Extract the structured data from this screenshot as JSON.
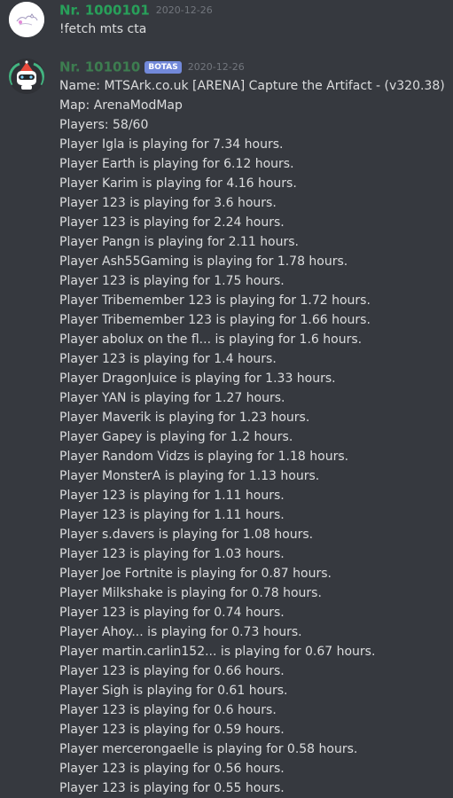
{
  "messages": [
    {
      "username": "Nr. 1000101",
      "timestamp": "2020-12-26",
      "text": "!fetch mts cta"
    },
    {
      "username": "Nr. 101010",
      "bot_tag": "BOTAS",
      "timestamp": "2020-12-26",
      "lines": [
        "Name: MTSArk.co.uk [ARENA] Capture the Artifact - (v320.38)",
        "Map: ArenaModMap",
        "Players: 58/60",
        "Player Igla is playing for 7.34 hours.",
        "Player Earth is playing for 6.12 hours.",
        "Player Karim is playing for 4.16 hours.",
        "Player 123 is playing for 3.6 hours.",
        "Player 123 is playing for 2.24 hours.",
        "Player Pangn is playing for 2.11 hours.",
        "Player Ash55Gaming is playing for 1.78 hours.",
        "Player 123 is playing for 1.75 hours.",
        "Player Tribemember 123 is playing for 1.72 hours.",
        "Player Tribemember 123 is playing for 1.66 hours.",
        "Player abolux on the fl... is playing for 1.6 hours.",
        "Player 123 is playing for 1.4 hours.",
        "Player DragonJuice is playing for 1.33 hours.",
        "Player YAN is playing for 1.27 hours.",
        "Player Maverik is playing for 1.23 hours.",
        "Player Gapey is playing for 1.2 hours.",
        "Player Random Vidzs is playing for 1.18 hours.",
        "Player MonsterA is playing for 1.13 hours.",
        "Player 123 is playing for 1.11 hours.",
        "Player 123 is playing for 1.11 hours.",
        "Player s.davers is playing for 1.08 hours.",
        "Player 123 is playing for 1.03 hours.",
        "Player Joe Fortnite is playing for 0.87 hours.",
        "Player Milkshake is playing for 0.78 hours.",
        "Player 123 is playing for 0.74 hours.",
        "Player Ahoy... is playing for 0.73 hours.",
        "Player martin.carlin152... is playing for 0.67 hours.",
        "Player 123 is playing for 0.66 hours.",
        "Player Sigh is playing for 0.61 hours.",
        "Player 123 is playing for 0.6 hours.",
        "Player 123 is playing for 0.59 hours.",
        "Player mercerongaelle is playing for 0.58 hours.",
        "Player 123 is playing for 0.56 hours.",
        "Player 123 is playing for 0.55 hours."
      ]
    }
  ],
  "colors": {
    "background": "#36393f",
    "text": "#dcddde",
    "username": "#3d7d50",
    "bot_tag": "#7289da",
    "timestamp": "#72767d"
  }
}
